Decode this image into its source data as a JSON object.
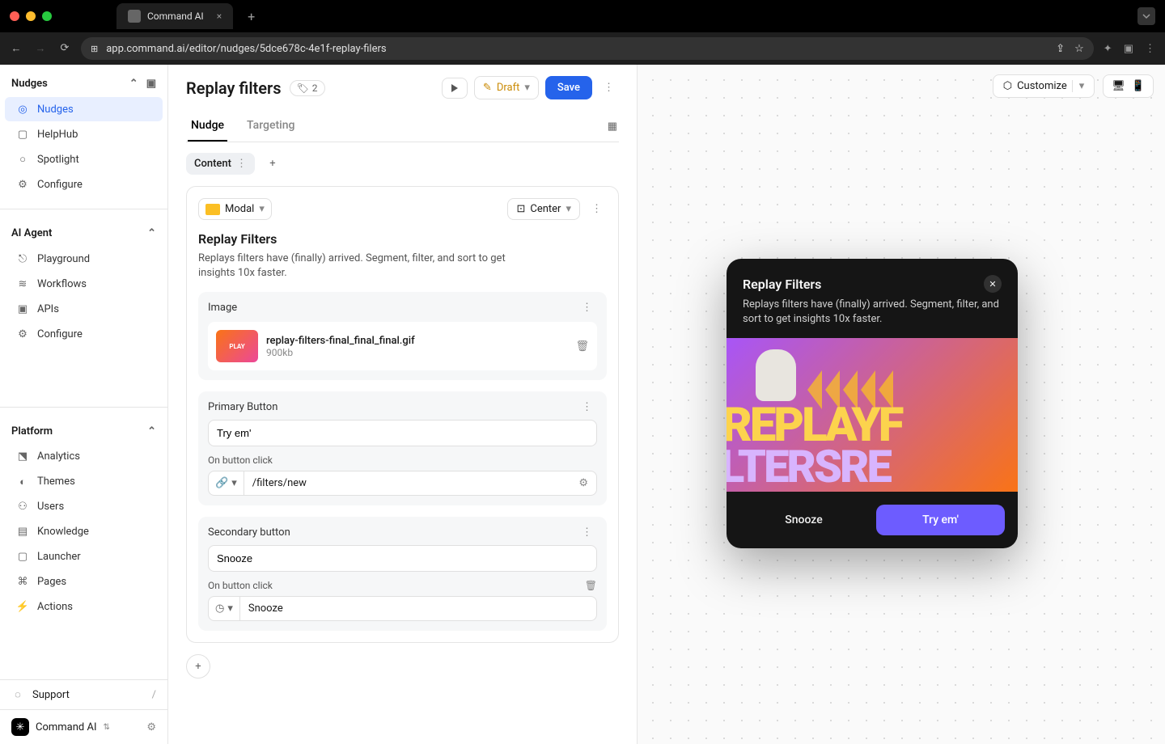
{
  "browser": {
    "tab_title": "Command AI",
    "url": "app.command.ai/editor/nudges/5dce678c-4e1f-replay-filers"
  },
  "sidebar": {
    "sections": [
      {
        "title": "Nudges",
        "items": [
          {
            "label": "Nudges",
            "active": true
          },
          {
            "label": "HelpHub"
          },
          {
            "label": "Spotlight"
          },
          {
            "label": "Configure"
          }
        ]
      },
      {
        "title": "AI Agent",
        "items": [
          {
            "label": "Playground"
          },
          {
            "label": "Workflows"
          },
          {
            "label": "APIs"
          },
          {
            "label": "Configure"
          }
        ]
      },
      {
        "title": "Platform",
        "items": [
          {
            "label": "Analytics"
          },
          {
            "label": "Themes"
          },
          {
            "label": "Users"
          },
          {
            "label": "Knowledge"
          },
          {
            "label": "Launcher"
          },
          {
            "label": "Pages"
          },
          {
            "label": "Actions"
          }
        ]
      }
    ],
    "support_label": "Support",
    "support_shortcut": "/",
    "brand": "Command AI"
  },
  "editor": {
    "title": "Replay filters",
    "tag_count": "2",
    "status": "Draft",
    "save_label": "Save",
    "tabs": [
      "Nudge",
      "Targeting"
    ],
    "subtab": "Content",
    "card": {
      "type": "Modal",
      "position": "Center",
      "headline": "Replay Filters",
      "body": "Replays filters have (finally) arrived. Segment, filter, and sort to get insights 10x faster.",
      "image_block_label": "Image",
      "image_file": "replay-filters-final_final_final.gif",
      "image_size": "900kb",
      "primary_label": "Primary Button",
      "primary_value": "Try em'",
      "on_click_label": "On button click",
      "primary_action": "/filters/new",
      "secondary_label": "Secondary button",
      "secondary_value": "Snooze",
      "secondary_action": "Snooze"
    }
  },
  "preview": {
    "customize_label": "Customize"
  },
  "modal": {
    "title": "Replay Filters",
    "desc": "Replays filters have (finally) arrived. Segment, filter, and sort to get insights 10x faster.",
    "img_t1": "REPLAYF",
    "img_t2": "LTERSRE",
    "secondary": "Snooze",
    "primary": "Try em'"
  }
}
